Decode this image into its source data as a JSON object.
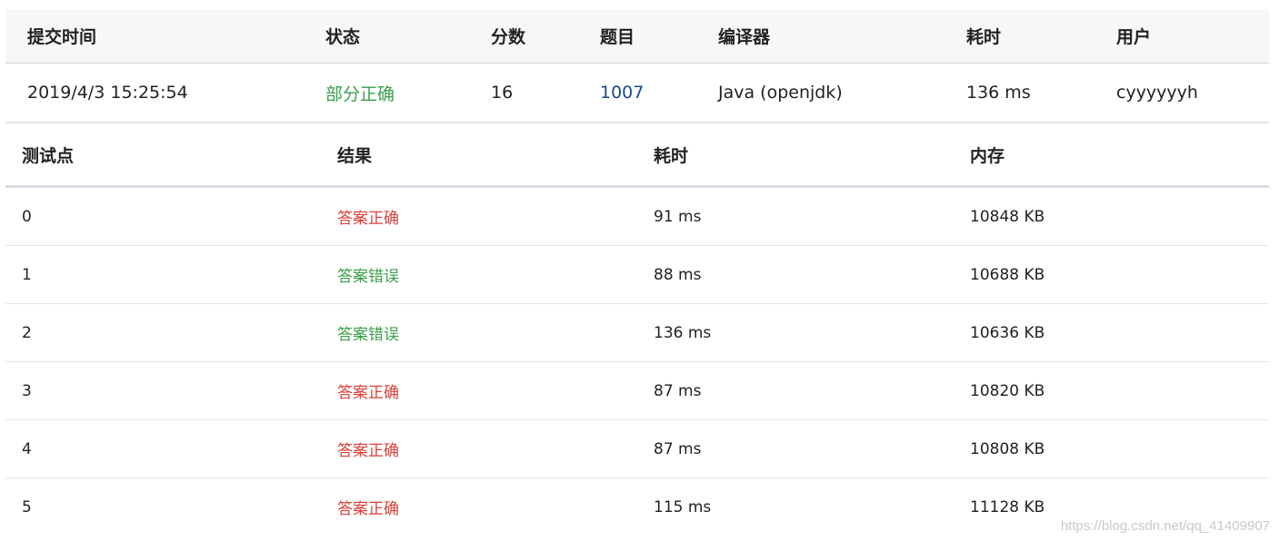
{
  "submission": {
    "headers": [
      "提交时间",
      "状态",
      "分数",
      "题目",
      "编译器",
      "耗时",
      "用户"
    ],
    "row": {
      "time": "2019/4/3 15:25:54",
      "status": "部分正确",
      "score": "16",
      "problem": "1007",
      "compiler": "Java (openjdk)",
      "elapsed": "136 ms",
      "user": "cyyyyyyh"
    }
  },
  "cases": {
    "headers": [
      "测试点",
      "结果",
      "耗时",
      "内存"
    ],
    "rows": [
      {
        "id": "0",
        "result": "答案正确",
        "time": "91 ms",
        "memory": "10848 KB"
      },
      {
        "id": "1",
        "result": "答案错误",
        "time": "88 ms",
        "memory": "10688 KB"
      },
      {
        "id": "2",
        "result": "答案错误",
        "time": "136 ms",
        "memory": "10636 KB"
      },
      {
        "id": "3",
        "result": "答案正确",
        "time": "87 ms",
        "memory": "10820 KB"
      },
      {
        "id": "4",
        "result": "答案正确",
        "time": "87 ms",
        "memory": "10808 KB"
      },
      {
        "id": "5",
        "result": "答案正确",
        "time": "115 ms",
        "memory": "11128 KB"
      }
    ]
  },
  "colors": {
    "status_partial": "#3a9e4a",
    "result_correct": "#d9413a",
    "result_wrong": "#3a9e4a",
    "link": "#1a4a8a"
  },
  "watermark": "https://blog.csdn.net/qq_41409907"
}
